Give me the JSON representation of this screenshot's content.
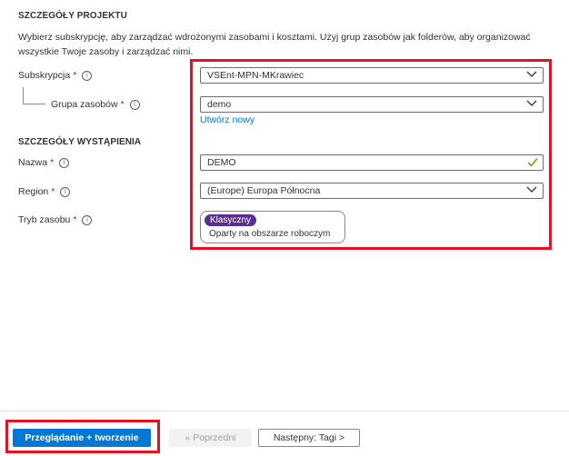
{
  "project": {
    "heading": "SZCZEGÓŁY PROJEKTU",
    "description": "Wybierz subskrypcję, aby zarządzać wdrożonymi zasobami i kosztami. Użyj grup zasobów jak folderów, aby organizować wszystkie Twoje zasoby i zarządzać nimi.",
    "subscription": {
      "label": "Subskrypcja",
      "required": "*",
      "value": "VSEnt-MPN-MKrawiec"
    },
    "resource_group": {
      "label": "Grupa zasobów",
      "required": "*",
      "value": "demo",
      "create_new": "Utwórz nowy"
    }
  },
  "instance": {
    "heading": "SZCZEGÓŁY WYSTĄPIENIA",
    "name": {
      "label": "Nazwa",
      "required": "*",
      "value": "DEMO"
    },
    "region": {
      "label": "Region",
      "required": "*",
      "value": "(Europe) Europa Północna"
    },
    "resource_mode": {
      "label": "Tryb zasobu",
      "required": "*",
      "badge": "Klasyczny",
      "option": "Oparty na obszarze roboczym"
    }
  },
  "footer": {
    "review_create": "Przeglądanie + tworzenie",
    "previous": "« Poprzedni",
    "next": "Następny: Tagi >"
  },
  "colors": {
    "accent": "#0078d4",
    "highlight": "#e81123",
    "badge": "#5c2d91",
    "required": "#a4262c",
    "valid": "#57a300"
  },
  "icons": {
    "info": "info-icon",
    "dropdown": "chevron-down-icon",
    "valid": "checkmark-icon"
  }
}
